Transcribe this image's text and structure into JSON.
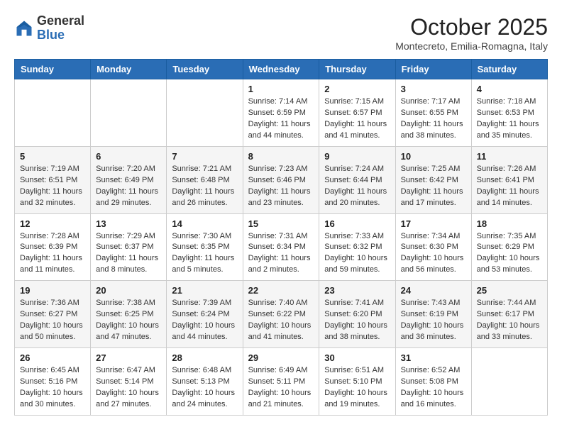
{
  "header": {
    "logo_general": "General",
    "logo_blue": "Blue",
    "month_title": "October 2025",
    "subtitle": "Montecreto, Emilia-Romagna, Italy"
  },
  "days_of_week": [
    "Sunday",
    "Monday",
    "Tuesday",
    "Wednesday",
    "Thursday",
    "Friday",
    "Saturday"
  ],
  "weeks": [
    [
      {
        "day": "",
        "info": ""
      },
      {
        "day": "",
        "info": ""
      },
      {
        "day": "",
        "info": ""
      },
      {
        "day": "1",
        "info": "Sunrise: 7:14 AM\nSunset: 6:59 PM\nDaylight: 11 hours and 44 minutes."
      },
      {
        "day": "2",
        "info": "Sunrise: 7:15 AM\nSunset: 6:57 PM\nDaylight: 11 hours and 41 minutes."
      },
      {
        "day": "3",
        "info": "Sunrise: 7:17 AM\nSunset: 6:55 PM\nDaylight: 11 hours and 38 minutes."
      },
      {
        "day": "4",
        "info": "Sunrise: 7:18 AM\nSunset: 6:53 PM\nDaylight: 11 hours and 35 minutes."
      }
    ],
    [
      {
        "day": "5",
        "info": "Sunrise: 7:19 AM\nSunset: 6:51 PM\nDaylight: 11 hours and 32 minutes."
      },
      {
        "day": "6",
        "info": "Sunrise: 7:20 AM\nSunset: 6:49 PM\nDaylight: 11 hours and 29 minutes."
      },
      {
        "day": "7",
        "info": "Sunrise: 7:21 AM\nSunset: 6:48 PM\nDaylight: 11 hours and 26 minutes."
      },
      {
        "day": "8",
        "info": "Sunrise: 7:23 AM\nSunset: 6:46 PM\nDaylight: 11 hours and 23 minutes."
      },
      {
        "day": "9",
        "info": "Sunrise: 7:24 AM\nSunset: 6:44 PM\nDaylight: 11 hours and 20 minutes."
      },
      {
        "day": "10",
        "info": "Sunrise: 7:25 AM\nSunset: 6:42 PM\nDaylight: 11 hours and 17 minutes."
      },
      {
        "day": "11",
        "info": "Sunrise: 7:26 AM\nSunset: 6:41 PM\nDaylight: 11 hours and 14 minutes."
      }
    ],
    [
      {
        "day": "12",
        "info": "Sunrise: 7:28 AM\nSunset: 6:39 PM\nDaylight: 11 hours and 11 minutes."
      },
      {
        "day": "13",
        "info": "Sunrise: 7:29 AM\nSunset: 6:37 PM\nDaylight: 11 hours and 8 minutes."
      },
      {
        "day": "14",
        "info": "Sunrise: 7:30 AM\nSunset: 6:35 PM\nDaylight: 11 hours and 5 minutes."
      },
      {
        "day": "15",
        "info": "Sunrise: 7:31 AM\nSunset: 6:34 PM\nDaylight: 11 hours and 2 minutes."
      },
      {
        "day": "16",
        "info": "Sunrise: 7:33 AM\nSunset: 6:32 PM\nDaylight: 10 hours and 59 minutes."
      },
      {
        "day": "17",
        "info": "Sunrise: 7:34 AM\nSunset: 6:30 PM\nDaylight: 10 hours and 56 minutes."
      },
      {
        "day": "18",
        "info": "Sunrise: 7:35 AM\nSunset: 6:29 PM\nDaylight: 10 hours and 53 minutes."
      }
    ],
    [
      {
        "day": "19",
        "info": "Sunrise: 7:36 AM\nSunset: 6:27 PM\nDaylight: 10 hours and 50 minutes."
      },
      {
        "day": "20",
        "info": "Sunrise: 7:38 AM\nSunset: 6:25 PM\nDaylight: 10 hours and 47 minutes."
      },
      {
        "day": "21",
        "info": "Sunrise: 7:39 AM\nSunset: 6:24 PM\nDaylight: 10 hours and 44 minutes."
      },
      {
        "day": "22",
        "info": "Sunrise: 7:40 AM\nSunset: 6:22 PM\nDaylight: 10 hours and 41 minutes."
      },
      {
        "day": "23",
        "info": "Sunrise: 7:41 AM\nSunset: 6:20 PM\nDaylight: 10 hours and 38 minutes."
      },
      {
        "day": "24",
        "info": "Sunrise: 7:43 AM\nSunset: 6:19 PM\nDaylight: 10 hours and 36 minutes."
      },
      {
        "day": "25",
        "info": "Sunrise: 7:44 AM\nSunset: 6:17 PM\nDaylight: 10 hours and 33 minutes."
      }
    ],
    [
      {
        "day": "26",
        "info": "Sunrise: 6:45 AM\nSunset: 5:16 PM\nDaylight: 10 hours and 30 minutes."
      },
      {
        "day": "27",
        "info": "Sunrise: 6:47 AM\nSunset: 5:14 PM\nDaylight: 10 hours and 27 minutes."
      },
      {
        "day": "28",
        "info": "Sunrise: 6:48 AM\nSunset: 5:13 PM\nDaylight: 10 hours and 24 minutes."
      },
      {
        "day": "29",
        "info": "Sunrise: 6:49 AM\nSunset: 5:11 PM\nDaylight: 10 hours and 21 minutes."
      },
      {
        "day": "30",
        "info": "Sunrise: 6:51 AM\nSunset: 5:10 PM\nDaylight: 10 hours and 19 minutes."
      },
      {
        "day": "31",
        "info": "Sunrise: 6:52 AM\nSunset: 5:08 PM\nDaylight: 10 hours and 16 minutes."
      },
      {
        "day": "",
        "info": ""
      }
    ]
  ]
}
